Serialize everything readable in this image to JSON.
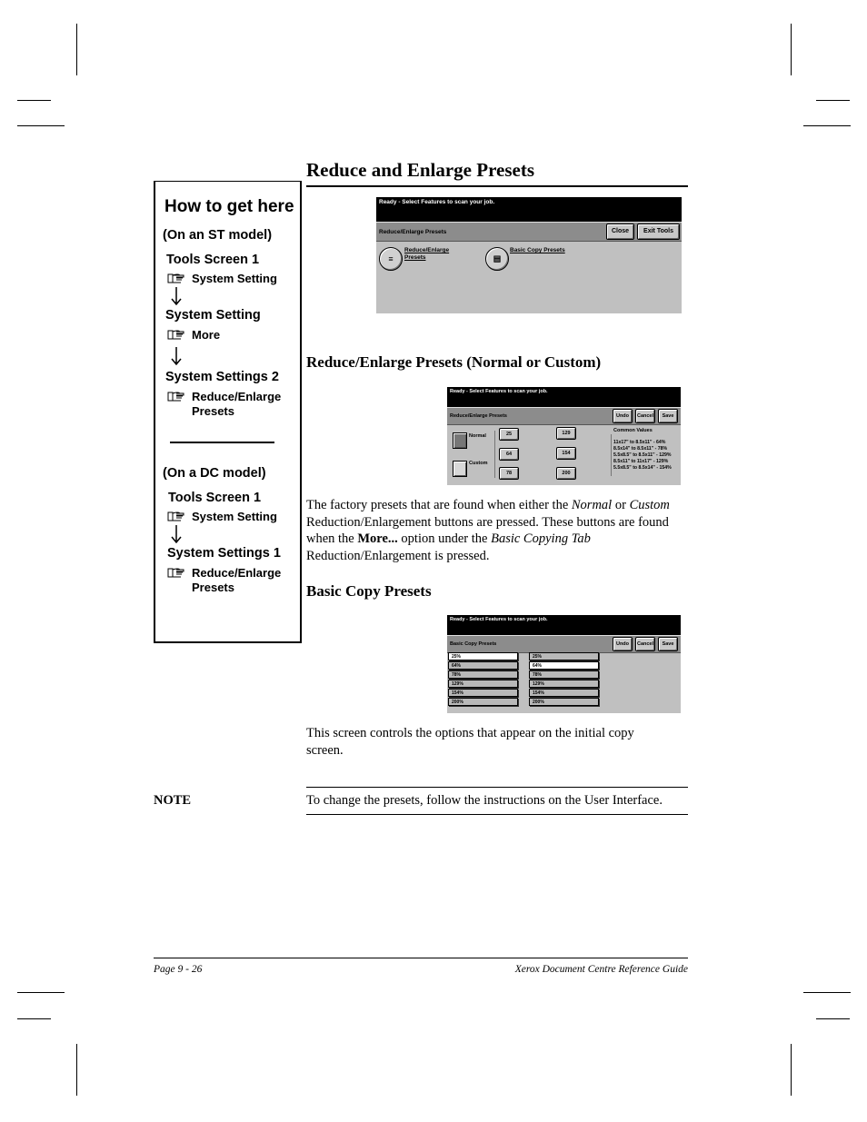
{
  "page": {
    "title": "Reduce and Enlarge Presets"
  },
  "how_to": {
    "heading": "How to get here",
    "st_model": {
      "label": "(On an ST model)",
      "steps": [
        {
          "screen": "Tools Screen 1",
          "press": "System Setting"
        },
        {
          "screen": "System Setting",
          "press": "More"
        },
        {
          "screen": "System Settings 2",
          "press_line1": "Reduce/Enlarge",
          "press_line2": "Presets"
        }
      ]
    },
    "dc_model": {
      "label": "(On a DC model)",
      "steps": [
        {
          "screen": "Tools Screen 1",
          "press": "System Setting"
        },
        {
          "screen": "System Settings 1",
          "press_line1": "Reduce/Enlarge",
          "press_line2": "Presets"
        }
      ]
    },
    "icons": {
      "press": "pointing-hand-icon",
      "next": "down-arrow-icon"
    }
  },
  "screen_main": {
    "status": "Ready -  Select Features to scan your job.",
    "header": "Reduce/Enlarge Presets",
    "buttons": {
      "close": "Close",
      "exit_tools": "Exit Tools"
    },
    "options": [
      {
        "line1": "Reduce/Enlarge",
        "line2": "Presets",
        "icon": "reduce-enlarge-icon"
      },
      {
        "line1": "Basic Copy Presets",
        "line2": "",
        "icon": "basic-copy-icon"
      }
    ]
  },
  "section_normal_custom": {
    "heading": "Reduce/Enlarge Presets (Normal or Custom)",
    "screen": {
      "status": "Ready -  Select Features to scan your job.",
      "header": "Reduce/Enlarge Presets",
      "buttons": {
        "undo": "Undo",
        "cancel": "Cancel",
        "save": "Save"
      },
      "modes": [
        {
          "label": "Normal",
          "selected": true
        },
        {
          "label": "Custom",
          "selected": false
        }
      ],
      "values_left": [
        "25",
        "64",
        "78"
      ],
      "values_right": [
        "129",
        "154",
        "200"
      ],
      "common_title": "Common Values",
      "common_values": [
        "11x17\" to 8.5x11\" - 64%",
        "8.5x14\" to 8.5x11\" - 78%",
        "5.5x8.5\" to 8.5x11\" - 129%",
        "8.5x11\" to 11x17\" - 129%",
        "5.5x8.5\" to 8.5x14\" - 154%"
      ]
    },
    "paragraph": {
      "p1": "The factory presets that are found when either the ",
      "normal": "Normal",
      "p2": " or ",
      "custom": "Custom",
      "p3": " Reduction/Enlargement buttons are pressed. These buttons are found when the ",
      "more": "More...",
      "p4": " option under the ",
      "tab": "Basic Copying Tab",
      "p5": " Reduction/Enlargement is pressed."
    }
  },
  "section_basic_copy": {
    "heading": "Basic Copy Presets",
    "screen": {
      "status": "Ready -  Select Features to scan your job.",
      "header": "Basic Copy Presets",
      "buttons": {
        "undo": "Undo",
        "cancel": "Cancel",
        "save": "Save"
      },
      "column_left": [
        "25%",
        "64%",
        "78%",
        "129%",
        "154%",
        "200%"
      ],
      "column_right": [
        "25%",
        "64%",
        "78%",
        "129%",
        "154%",
        "200%"
      ],
      "selected_left": "25%",
      "selected_right": "64%"
    },
    "paragraph": "This screen controls the options that appear on the initial copy screen."
  },
  "note": {
    "label": "NOTE",
    "text": "To change the presets, follow the instructions on the User Interface."
  },
  "footer": {
    "page": "Page 9 - 26",
    "guide": "Xerox Document Centre Reference Guide"
  }
}
